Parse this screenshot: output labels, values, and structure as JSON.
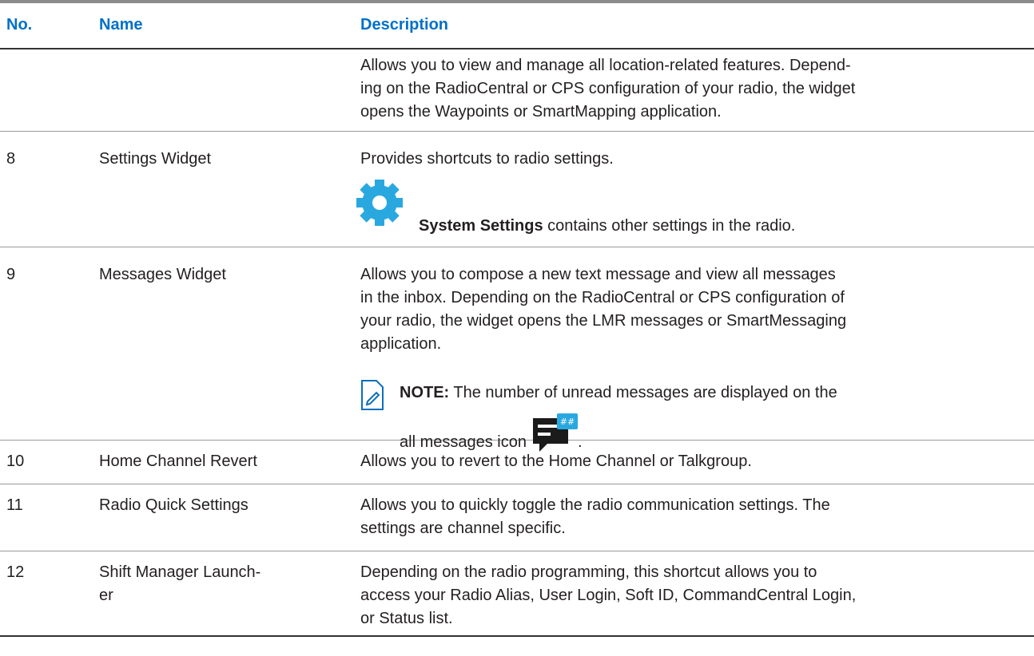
{
  "table": {
    "headers": [
      "No.",
      "Name",
      "Description"
    ],
    "rows": [
      {
        "no": "",
        "name": "",
        "desc": "Allows you to view and manage all location-related features. Depend-ing on the RadioCentral or CPS configuration of your radio, the widget opens the Waypoints or SmartMapping application.",
        "desc_lines": [
          "Allows you to view and manage all location-related features. Depend-",
          "ing on the RadioCentral or CPS configuration of your radio, the widget",
          "opens the Waypoints or SmartMapping application."
        ]
      },
      {
        "no": "8",
        "name": "Settings Widget",
        "desc": "Provides shortcuts to radio settings.",
        "extra_icon": "gear-icon",
        "extra_bold": "System Settings",
        "extra_rest": " contains other settings in the radio."
      },
      {
        "no": "9",
        "name": "Messages Widget",
        "desc_lines": [
          "Allows you to compose a new text message and view all messages",
          "in the inbox. Depending on the RadioCentral or CPS configuration of",
          "your radio, the widget opens the LMR messages or SmartMessaging",
          "application."
        ],
        "note_label": "NOTE:",
        "note_text_1": " The number of unread messages are displayed on the",
        "note_text_2": "all messages icon",
        "note_end": ".",
        "note_icon": "note-icon",
        "message_icon": "all-messages-icon"
      },
      {
        "no": "10",
        "name": "Home Channel Revert",
        "desc": "Allows you to revert to the Home Channel or Talkgroup."
      },
      {
        "no": "11",
        "name": "Radio Quick Settings",
        "desc_lines": [
          "Allows you to quickly toggle the radio communication settings. The",
          "settings are channel specific."
        ]
      },
      {
        "no": "12",
        "name_lines": [
          "Shift Manager Launch-",
          "er"
        ],
        "desc_lines": [
          "Depending on the radio programming, this shortcut allows you to",
          "access your Radio Alias, User Login, Soft ID, CommandCentral Login,",
          "or Status list."
        ]
      }
    ]
  },
  "colors": {
    "header_text": "#0070c8",
    "icon_blue": "#29a8e0",
    "note_blue": "#0d6fba",
    "msg_dark": "#1b1b1b"
  }
}
